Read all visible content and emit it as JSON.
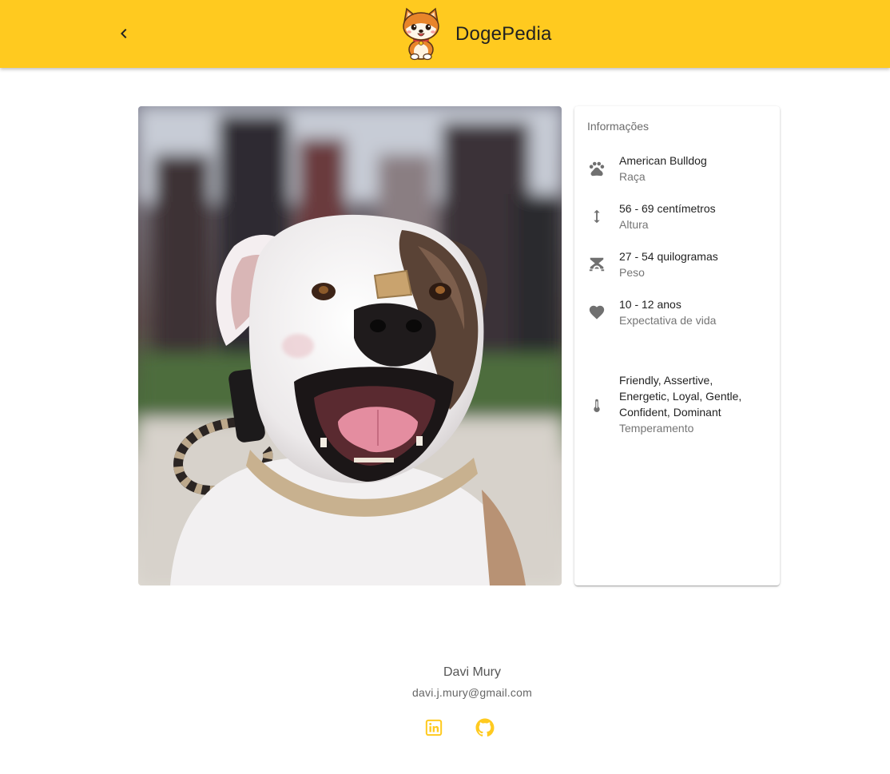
{
  "header": {
    "title": "DogePedia",
    "back_icon": "chevron-left-icon",
    "logo": "shiba-inu-logo",
    "background_color": "#ffca1f"
  },
  "photo": {
    "subject": "American Bulldog photo"
  },
  "info_card": {
    "heading": "Informações",
    "items": [
      {
        "icon": "paw-icon",
        "value": "American Bulldog",
        "label": "Raça"
      },
      {
        "icon": "height-arrows-icon",
        "value": "56 - 69 centímetros",
        "label": "Altura"
      },
      {
        "icon": "scale-icon",
        "value": "27 - 54 quilogramas",
        "label": "Peso"
      },
      {
        "icon": "heart-icon",
        "value": "10 - 12 anos",
        "label": "Expectativa de vida"
      },
      {
        "icon": "thermometer-icon",
        "value_lines": [
          "Friendly, Assertive,",
          "Energetic, Loyal, Gentle,",
          "Confident, Dominant"
        ],
        "label": "Temperamento"
      }
    ]
  },
  "footer": {
    "name": "Davi Mury",
    "email": "davi.j.mury@gmail.com",
    "links": [
      {
        "icon": "linkedin-icon"
      },
      {
        "icon": "github-icon"
      }
    ],
    "accent_color": "#ffca1f"
  }
}
